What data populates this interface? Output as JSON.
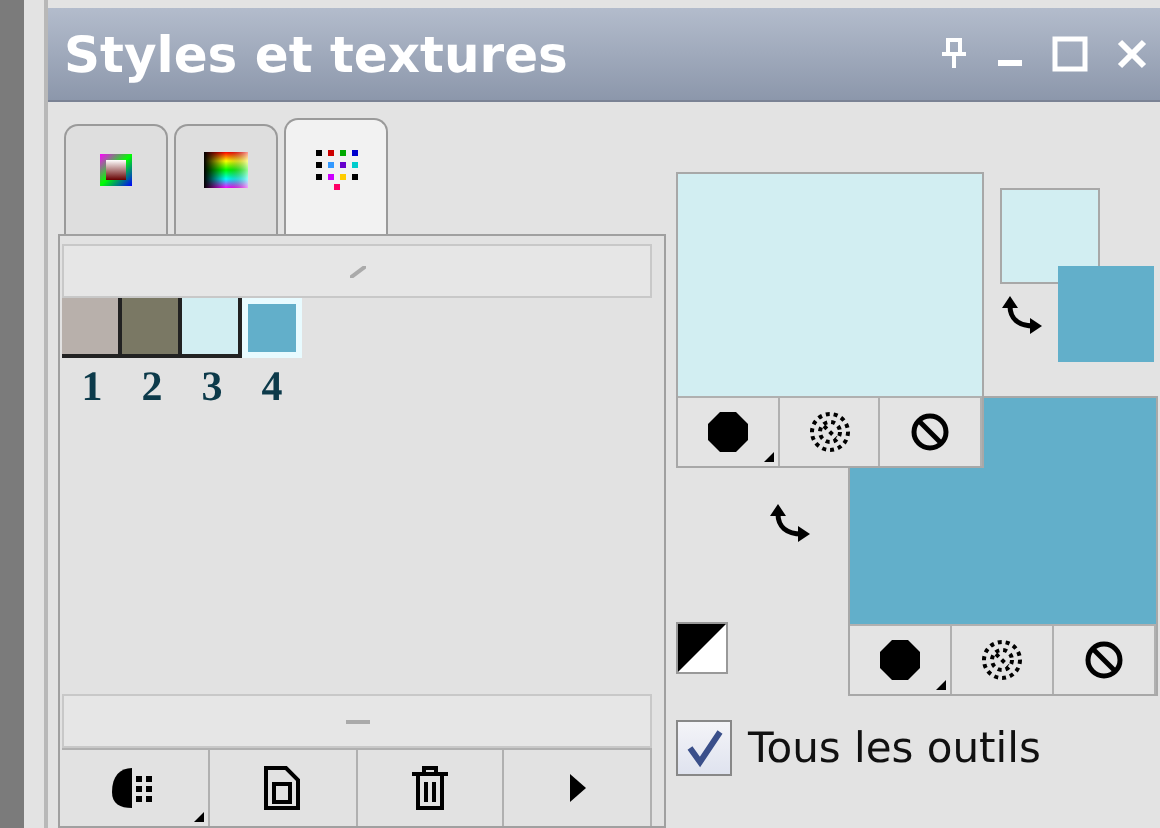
{
  "window": {
    "title": "Styles et textures"
  },
  "tabs": [
    {
      "kind": "material",
      "selected": false
    },
    {
      "kind": "spectrum",
      "selected": false
    },
    {
      "kind": "swatches",
      "selected": true
    }
  ],
  "swatches": [
    {
      "number": "1",
      "color": "#b8b0ab",
      "selected": false
    },
    {
      "number": "2",
      "color": "#7a7864",
      "selected": false
    },
    {
      "number": "3",
      "color": "#d2eef2",
      "selected": false
    },
    {
      "number": "4",
      "color": "#62afca",
      "selected": true
    }
  ],
  "foreground": {
    "color": "#d2eef2"
  },
  "background": {
    "color": "#62afca"
  },
  "all_tools": {
    "label": "Tous les outils",
    "checked": true
  }
}
